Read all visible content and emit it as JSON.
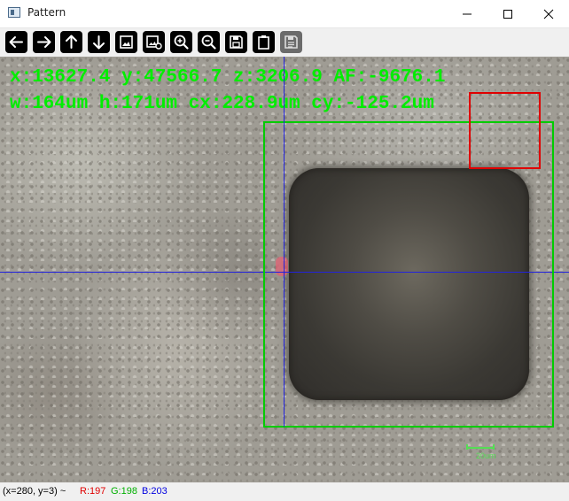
{
  "window": {
    "title": "Pattern",
    "controls": {
      "minimize_icon": "minimize-icon",
      "maximize_icon": "maximize-icon",
      "close_icon": "close-icon"
    }
  },
  "toolbar": {
    "buttons": [
      {
        "icon": "arrow-left-icon"
      },
      {
        "icon": "arrow-right-icon"
      },
      {
        "icon": "arrow-up-icon"
      },
      {
        "icon": "arrow-down-icon"
      },
      {
        "icon": "image-icon"
      },
      {
        "icon": "image-settings-icon"
      },
      {
        "icon": "zoom-in-icon"
      },
      {
        "icon": "zoom-out-icon"
      },
      {
        "icon": "save-icon"
      },
      {
        "icon": "clipboard-icon"
      },
      {
        "icon": "properties-icon",
        "disabled": true
      }
    ]
  },
  "overlay": {
    "line1": "x:13627.4 y:47566.7 z:3206.9 AF:-9676.1",
    "line2": "w:164um h:171um cx:228.9um cy:-125.2um",
    "text_color": "#00ee00"
  },
  "scale_bar": {
    "label": "20um",
    "color": "#55dd55"
  },
  "annotation_colors": {
    "pattern_box": "#00cc00",
    "roi_box": "#e00000",
    "crosshair": "#2222dd"
  },
  "status": {
    "coords": "(x=280, y=3) ~",
    "r": "R:197",
    "g": "G:198",
    "b": "B:203",
    "r_color": "#e00000",
    "g_color": "#00b000",
    "b_color": "#0000e0"
  }
}
